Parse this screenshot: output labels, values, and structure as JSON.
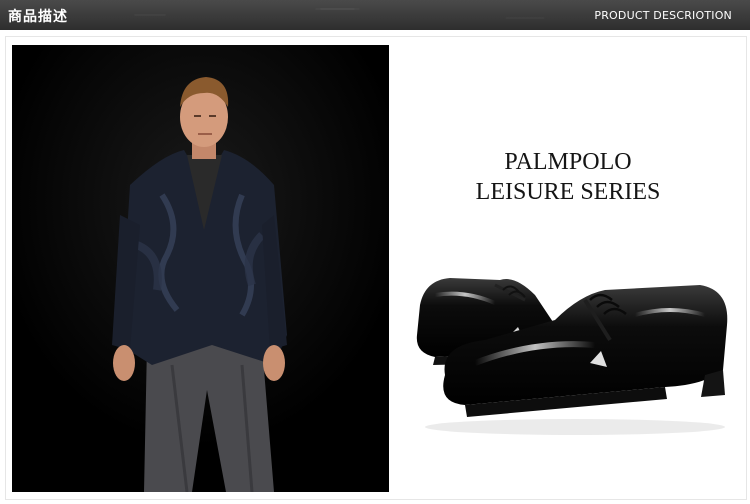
{
  "header": {
    "title": "商品描述",
    "subtitle": "PRODUCT DESCRIOTION"
  },
  "brand": {
    "line1": "PALMPOLO",
    "line2": "LEISURE SERIES"
  },
  "colors": {
    "header_bg": "#3f3f3f",
    "photo_bg": "#050505",
    "text_dark": "#151515"
  }
}
